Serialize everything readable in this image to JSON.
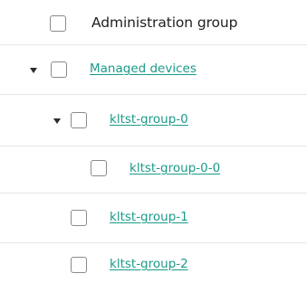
{
  "table": {
    "column_header": "Administration group",
    "rows": [
      {
        "label": "Managed devices",
        "level": 0,
        "expanded": true
      },
      {
        "label": "kltst-group-0",
        "level": 1,
        "expanded": true
      },
      {
        "label": "kltst-group-0-0",
        "level": 2,
        "expanded": false
      },
      {
        "label": "kltst-group-1",
        "level": 1,
        "expanded": false
      },
      {
        "label": "kltst-group-2",
        "level": 1,
        "expanded": false
      }
    ]
  },
  "colors": {
    "link": "#1a9b8a",
    "divider": "#e6e6e6",
    "checkbox_border": "#8a8a8a"
  }
}
